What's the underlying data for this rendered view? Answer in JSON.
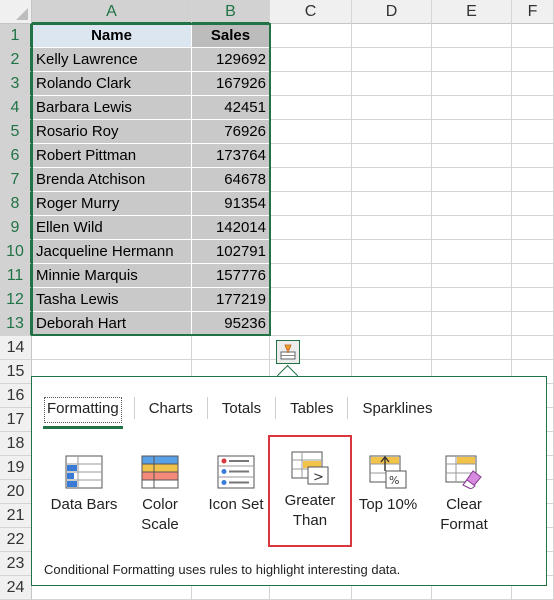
{
  "columns": [
    "A",
    "B",
    "C",
    "D",
    "E",
    "F"
  ],
  "rows": [
    "1",
    "2",
    "3",
    "4",
    "5",
    "6",
    "7",
    "8",
    "9",
    "10",
    "11",
    "12",
    "13",
    "14",
    "15",
    "16",
    "17",
    "18",
    "19",
    "20",
    "21",
    "22",
    "23",
    "24"
  ],
  "table": {
    "header_name": "Name",
    "header_sales": "Sales",
    "records": [
      {
        "name": "Kelly Lawrence",
        "sales": "129692"
      },
      {
        "name": "Rolando Clark",
        "sales": "167926"
      },
      {
        "name": "Barbara Lewis",
        "sales": "42451"
      },
      {
        "name": "Rosario Roy",
        "sales": "76926"
      },
      {
        "name": "Robert Pittman",
        "sales": "173764"
      },
      {
        "name": "Brenda Atchison",
        "sales": "64678"
      },
      {
        "name": "Roger Murry",
        "sales": "91354"
      },
      {
        "name": "Ellen Wild",
        "sales": "142014"
      },
      {
        "name": "Jacqueline Hermann",
        "sales": "102791"
      },
      {
        "name": "Minnie Marquis",
        "sales": "157776"
      },
      {
        "name": "Tasha Lewis",
        "sales": "177219"
      },
      {
        "name": "Deborah Hart",
        "sales": "95236"
      }
    ]
  },
  "quick_analysis": {
    "button_icon": "quick-analysis-icon",
    "tabs": [
      "Formatting",
      "Charts",
      "Totals",
      "Tables",
      "Sparklines"
    ],
    "active_tab": "Formatting",
    "options": [
      {
        "line1": "Data Bars",
        "line2": "",
        "icon": "data-bars-icon"
      },
      {
        "line1": "Color",
        "line2": "Scale",
        "icon": "color-scale-icon"
      },
      {
        "line1": "Icon Set",
        "line2": "",
        "icon": "icon-set-icon"
      },
      {
        "line1": "Greater",
        "line2": "Than",
        "icon": "greater-than-icon"
      },
      {
        "line1": "Top 10%",
        "line2": "",
        "icon": "top-10-icon"
      },
      {
        "line1": "Clear",
        "line2": "Format",
        "icon": "clear-format-icon"
      }
    ],
    "highlighted_option": "Greater Than",
    "description": "Conditional Formatting uses rules to highlight interesting data."
  },
  "colors": {
    "accent": "#217346",
    "highlight": "#d9363e",
    "selection_fill": "#c9c9c9"
  }
}
